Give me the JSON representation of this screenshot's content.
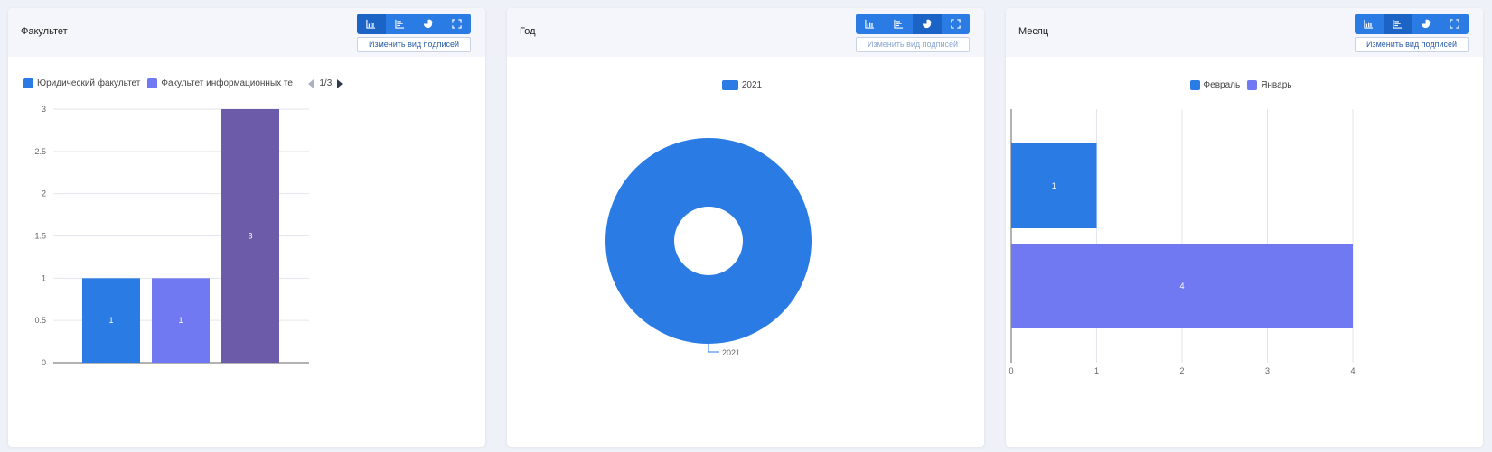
{
  "colors": {
    "blue": "#2b7be4",
    "periwinkle": "#7079f1",
    "purple": "#6b5ba8"
  },
  "view_buttons": [
    "bar-chart-icon",
    "horizontal-bar-icon",
    "pie-chart-icon",
    "fullscreen-icon"
  ],
  "panels": [
    {
      "title": "Факультет",
      "change_labels": "Изменить вид подписей",
      "legend": {
        "items": [
          {
            "label": "Юридический факультет",
            "color": "#2b7be4"
          },
          {
            "label": "Факультет информационных те",
            "color": "#7079f1"
          }
        ],
        "page": "1/3"
      }
    },
    {
      "title": "Год",
      "change_labels": "Изменить вид подписей",
      "legend": {
        "items": [
          {
            "label": "2021",
            "color": "#2b7be4"
          }
        ]
      }
    },
    {
      "title": "Месяц",
      "change_labels": "Изменить вид подписей",
      "legend": {
        "items": [
          {
            "label": "Февраль",
            "color": "#2b7be4"
          },
          {
            "label": "Январь",
            "color": "#7079f1"
          }
        ]
      }
    }
  ],
  "chart_data": [
    {
      "type": "bar",
      "categories": [
        "Юридический факультет",
        "Факультет информационных те",
        ""
      ],
      "values": [
        1,
        1,
        3
      ],
      "colors": [
        "#2b7be4",
        "#7079f1",
        "#6b5ba8"
      ],
      "data_labels": [
        "1",
        "1",
        "3"
      ],
      "ylim": [
        0,
        3
      ],
      "yticks": [
        "0",
        "0.5",
        "1",
        "1.5",
        "2",
        "2.5",
        "3"
      ],
      "grid": true
    },
    {
      "type": "pie",
      "categories": [
        "2021"
      ],
      "values": [
        1
      ],
      "colors": [
        "#2b7be4"
      ],
      "slice_label": "2021"
    },
    {
      "type": "bar",
      "orientation": "horizontal",
      "categories": [
        "Февраль",
        "Январь"
      ],
      "values": [
        1,
        4
      ],
      "colors": [
        "#2b7be4",
        "#7079f1"
      ],
      "data_labels": [
        "1",
        "4"
      ],
      "xlim": [
        0,
        4
      ],
      "xticks": [
        "0",
        "1",
        "2",
        "3",
        "4"
      ],
      "grid": true
    }
  ]
}
